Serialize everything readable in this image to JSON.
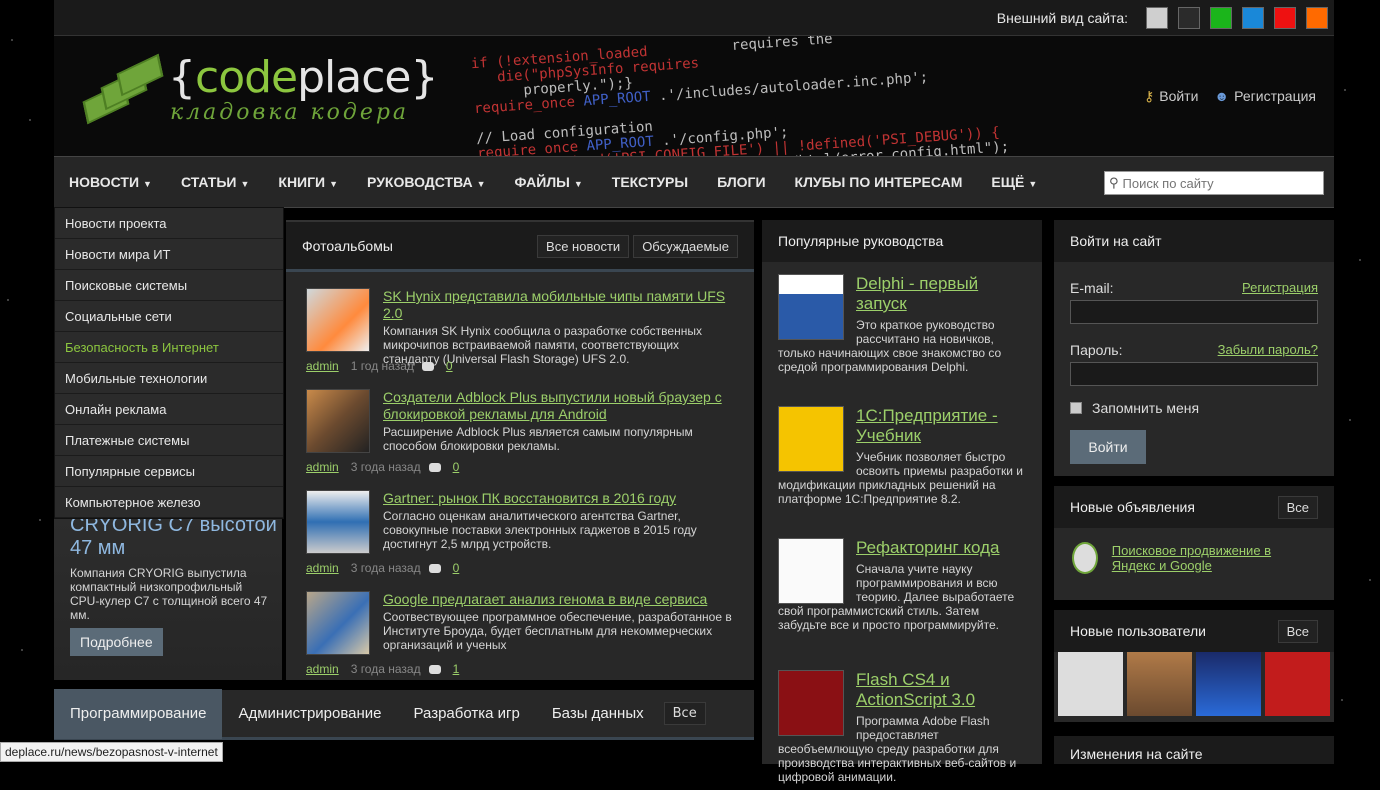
{
  "topbar": {
    "label": "Внешний вид сайта:",
    "swatches": [
      "#cfcfcf",
      "#2b2b2b",
      "#1bb51b",
      "#1a88d8",
      "#ee1111",
      "#ff6a00"
    ]
  },
  "logo": {
    "code": "code",
    "place": "place",
    "open": "{",
    "close": "}",
    "tagline": "кладовка кодера"
  },
  "auth": {
    "login": "Войти",
    "register": "Регистрация"
  },
  "nav": [
    "НОВОСТИ",
    "СТАТЬИ",
    "КНИГИ",
    "РУКОВОДСТВА",
    "ФАЙЛЫ",
    "ТЕКСТУРЫ",
    "БЛОГИ",
    "КЛУБЫ ПО ИНТЕРЕСАМ",
    "ЕЩЁ"
  ],
  "search": {
    "placeholder": "Поиск по сайту"
  },
  "dropdown": [
    "Новости проекта",
    "Новости мира ИТ",
    "Поисковые системы",
    "Социальные сети",
    "Безопасность в Интернет",
    "Мобильные технологии",
    "Онлайн реклама",
    "Платежные системы",
    "Популярные сервисы",
    "Компьютерное железо"
  ],
  "slider": {
    "title": "CRYORIG C7 высотой 47 мм",
    "desc": "Компания CRYORIG выпустила компактный низкопрофильный CPU-кулер C7 с толщиной всего 47 мм.",
    "button": "Подробнее"
  },
  "news": {
    "title": "Фотоальбомы",
    "btn_all": "Все новости",
    "btn_disc": "Обсуждаемые",
    "items": [
      {
        "title": "SK Hynix представила мобильные чипы памяти UFS 2.0",
        "desc": "Компания SK Hynix сообщила о разработке собственных микрочипов встраиваемой памяти, соответствующих стандарту (Universal Flash Storage) UFS 2.0.",
        "author": "admin",
        "time": "1 год назад",
        "comments": "0"
      },
      {
        "title": "Создатели Adblock Plus выпустили новый браузер с блокировкой рекламы для Android",
        "desc": "Расширение Adblock Plus является самым популярным способом блокировки рекламы.",
        "author": "admin",
        "time": "3 года назад",
        "comments": "0"
      },
      {
        "title": "Gartner: рынок ПК восстановится в 2016 году",
        "desc": "Согласно оценкам аналитического агентства Gartner, совокупные поставки электронных гаджетов в 2015 году достигнут 2,5 млрд устройств.",
        "author": "admin",
        "time": "3 года назад",
        "comments": "0"
      },
      {
        "title": "Google предлагает анализ генома в виде сервиса",
        "desc": "Соотвествующее программное обеспечение, разработанное в Институте Броуда, будет бесплатным для некоммерческих организаций и ученых",
        "author": "admin",
        "time": "3 года назад",
        "comments": "1"
      }
    ]
  },
  "guides": {
    "title": "Популярные руководства",
    "items": [
      {
        "title": "Delphi - первый запуск",
        "desc": "Это краткое руководство рассчитано на новичков, только начинающих свое знакомство со средой программирования Delphi."
      },
      {
        "title": "1С:Предприятие - Учебник",
        "desc": "Учебник позволяет быстро освоить приемы разработки и модификации прикладных решений на платформе 1С:Предприятие 8.2."
      },
      {
        "title": "Рефакторинг кода",
        "desc": "Сначала учите науку программирования и всю теорию. Далее выработаете свой программистский стиль. Затем забудьте все и просто программируйте."
      },
      {
        "title": "Flash CS4 и ActionScript 3.0",
        "desc": "Программа Adobe Flash предоставляет всеобъемлющую среду разработки для производства интерактивных веб-сайтов и цифровой анимации."
      }
    ]
  },
  "login": {
    "title": "Войти на сайт",
    "email": "E-mail:",
    "register": "Регистрация",
    "password": "Пароль:",
    "forgot": "Забыли пароль?",
    "remember": "Запомнить меня",
    "button": "Войти"
  },
  "ads": {
    "title": "Новые объявления",
    "all": "Все",
    "item": "Поисковое продвижение в Яндекс и Google"
  },
  "users": {
    "title": "Новые пользователи",
    "all": "Все"
  },
  "changes": {
    "title": "Изменения на сайте"
  },
  "tabs": {
    "items": [
      "Программирование",
      "Администрирование",
      "Разработка игр",
      "Базы данных"
    ],
    "all": "Все"
  },
  "status": "deplace.ru/news/bezopasnost-v-internet"
}
